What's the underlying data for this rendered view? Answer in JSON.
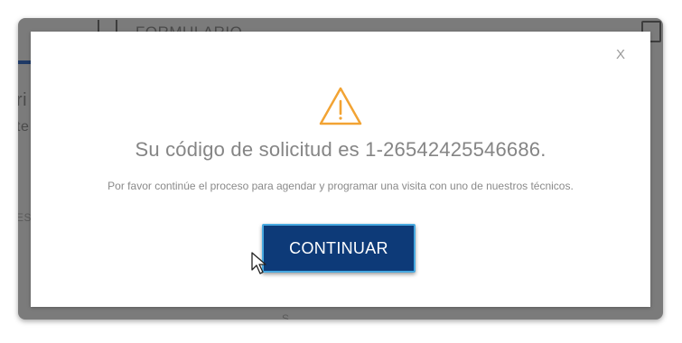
{
  "background": {
    "form_label": "FORMULARIO",
    "left_fragments": [
      "ri",
      "te",
      "ES"
    ],
    "bottom_fragment": "S"
  },
  "modal": {
    "close_label": "X",
    "icon": "warning-triangle-icon",
    "headline": "Su código de solicitud es 1-26542425546686.",
    "message": "Por favor continúe el proceso para agendar y programar una visita con uno de nuestros técnicos.",
    "continue_label": "CONTINUAR"
  },
  "colors": {
    "primary_button": "#0d3a78",
    "button_border": "#48a9e0",
    "warning": "#f2a333"
  }
}
